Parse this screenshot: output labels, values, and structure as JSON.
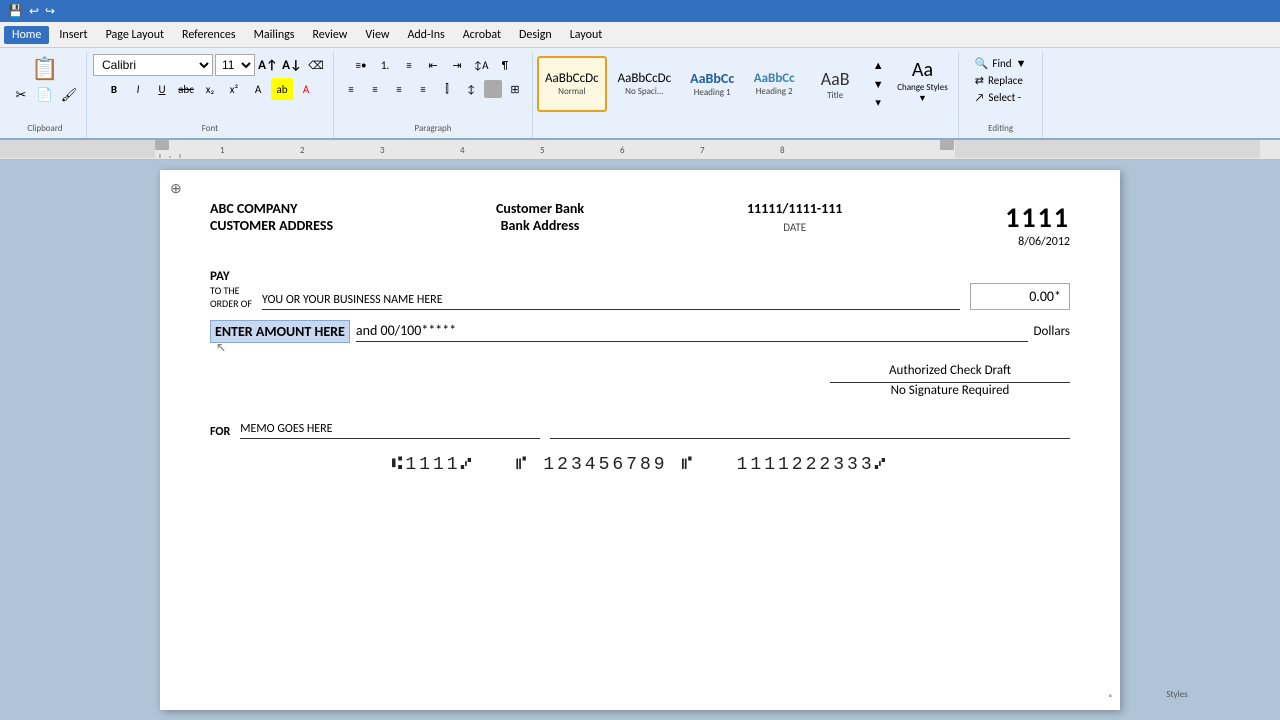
{
  "menu": {
    "items": [
      "Home",
      "Insert",
      "Page Layout",
      "References",
      "Mailings",
      "Review",
      "View",
      "Add-Ins",
      "Acrobat",
      "Design",
      "Layout"
    ]
  },
  "quick_access": {
    "icons": [
      "save",
      "undo",
      "redo"
    ]
  },
  "ribbon": {
    "font_name": "Calibri",
    "font_size": "11",
    "styles": [
      {
        "id": "normal",
        "label": "Normal",
        "preview": "AaBbCcDc",
        "active": true
      },
      {
        "id": "no-spacing",
        "label": "No Spaci...",
        "preview": "AaBbCcDc",
        "active": false
      },
      {
        "id": "heading1",
        "label": "Heading 1",
        "preview": "AaBbCc",
        "active": false
      },
      {
        "id": "heading2",
        "label": "Heading 2",
        "preview": "AaBbCc",
        "active": false
      },
      {
        "id": "title",
        "label": "Title",
        "preview": "AaB",
        "active": false
      }
    ],
    "change_styles_label": "Change Styles",
    "select_label": "Select -",
    "find_label": "Find",
    "replace_label": "Replace",
    "group_labels": {
      "font": "Font",
      "paragraph": "Paragraph",
      "styles": "Styles",
      "editing": "Editing"
    }
  },
  "check": {
    "company_name": "ABC COMPANY",
    "company_address": "CUSTOMER ADDRESS",
    "bank_name": "Customer Bank",
    "bank_address": "Bank Address",
    "routing": "11111/1111-111",
    "date_label": "DATE",
    "date_value": "8/06/2012",
    "check_number": "1111",
    "pay_label": "PAY",
    "pay_to_label": "TO THE\nORDER OF",
    "payee_line": "YOU OR YOUR BUSINESS NAME HERE",
    "amount_box": "0.00*",
    "amount_text_highlighted": "ENTER AMOUNT HERE",
    "amount_text_rest": "and 00/100*****",
    "dollars_label": "Dollars",
    "authorized_line1": "Authorized Check Draft",
    "authorized_line2": "No Signature Required",
    "for_label": "FOR",
    "memo_value": "MEMO GOES HERE",
    "micr_line": "⑆1111⑇   ⑈ 123456789 ⑈   1111222333⑇"
  }
}
